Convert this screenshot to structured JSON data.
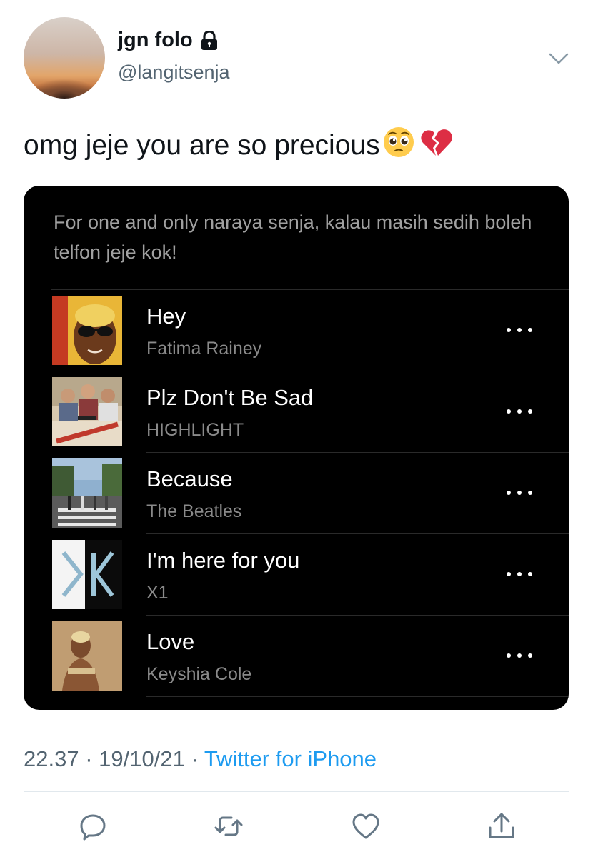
{
  "user": {
    "display_name": "jgn folo",
    "handle": "@langitsenja",
    "icons": {
      "protected": "lock-icon",
      "menu": "chevron-down-icon"
    }
  },
  "tweet": {
    "text": "omg jeje you are so precious",
    "emojis": [
      "pleading-face-emoji",
      "broken-heart-emoji"
    ]
  },
  "playlist": {
    "description": "For one and only naraya senja, kalau masih sedih boleh telfon jeje kok!",
    "songs": [
      {
        "title": "Hey",
        "artist": "Fatima Rainey"
      },
      {
        "title": "Plz Don't Be Sad",
        "artist": "HIGHLIGHT"
      },
      {
        "title": "Because",
        "artist": "The Beatles"
      },
      {
        "title": "I'm here for you",
        "artist": "X1"
      },
      {
        "title": "Love",
        "artist": "Keyshia Cole"
      }
    ]
  },
  "meta": {
    "time": "22.37",
    "separator": " · ",
    "date": "19/10/21",
    "source": "Twitter for iPhone"
  },
  "actions": [
    "reply-icon",
    "retweet-icon",
    "like-icon",
    "share-icon"
  ],
  "colors": {
    "link": "#1d9bf0",
    "card_bg": "#000000",
    "secondary_text": "#536471"
  }
}
